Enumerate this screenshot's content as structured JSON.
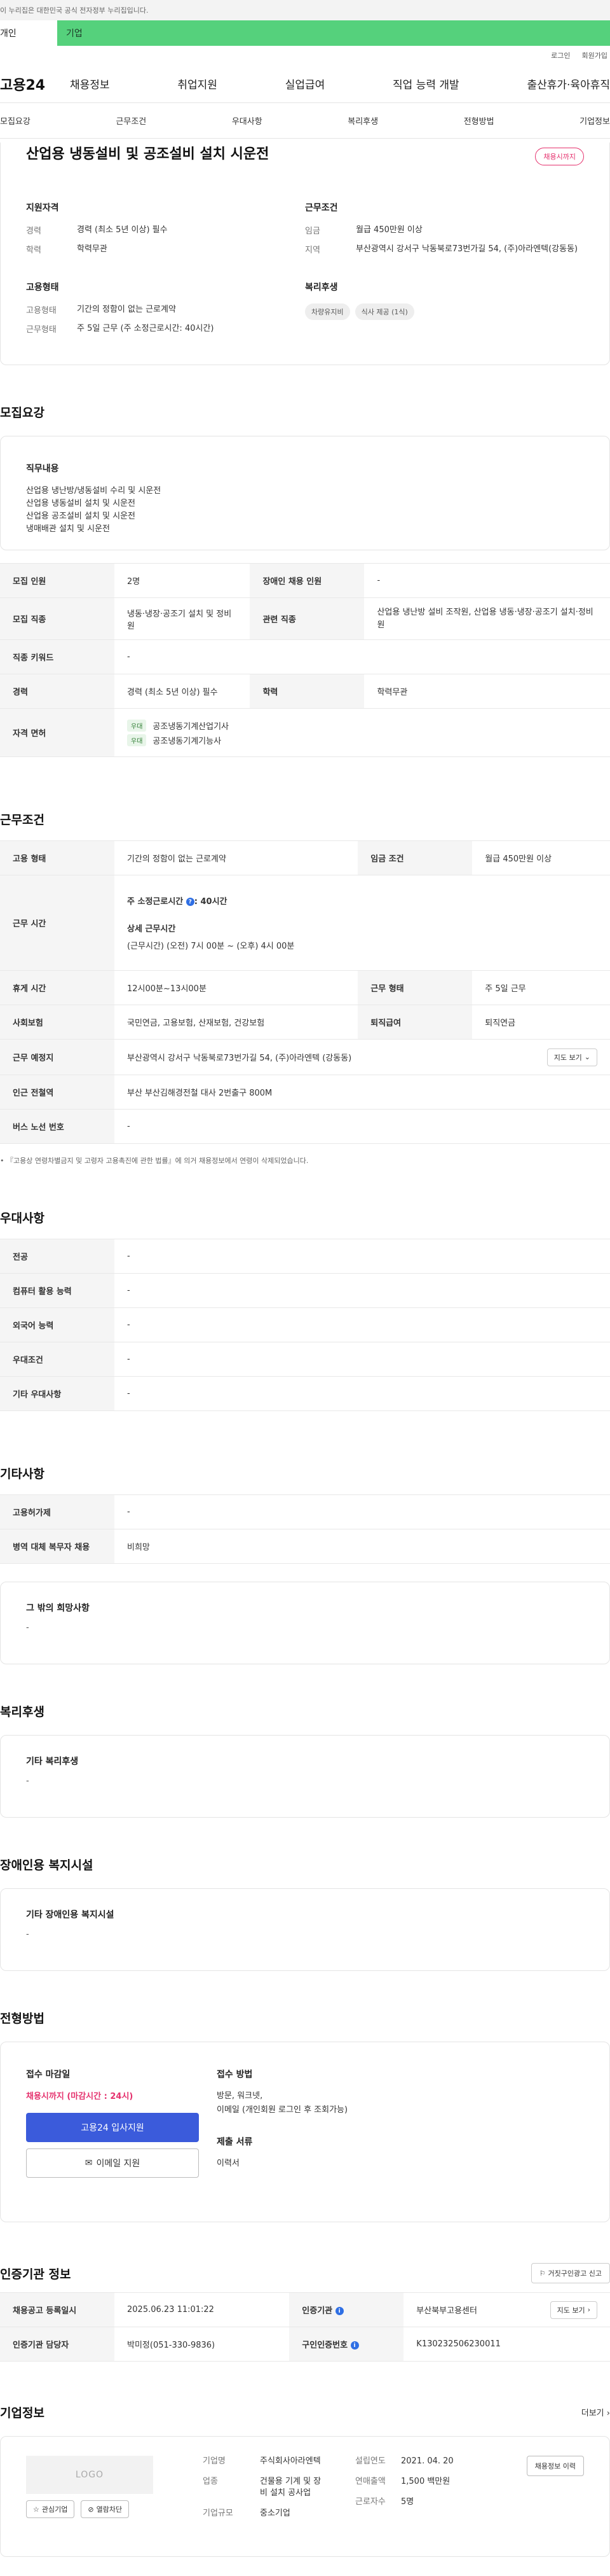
{
  "gov_bar": "이 누리집은 대한민국 공식 전자정부 누리집입니다.",
  "top_tabs": [
    "개인",
    "기업"
  ],
  "util": [
    "로그인",
    "회원가입"
  ],
  "logo": "고용24",
  "gnb": [
    "채용정보",
    "취업지원",
    "실업급여",
    "직업 능력 개발",
    "출산휴가·육아휴직"
  ],
  "subnav": [
    "모집요강",
    "근무조건",
    "우대사항",
    "복리후생",
    "전형방법",
    "기업정보"
  ],
  "summary": {
    "title": "산업용 냉동설비 및 공조설비 설치 시운전",
    "badge": "채용시까지",
    "qual_head": "지원자격",
    "qual": [
      {
        "k": "경력",
        "v": "경력 (최소 5년 이상) 필수"
      },
      {
        "k": "학력",
        "v": "학력무관"
      }
    ],
    "cond_head": "근무조건",
    "cond": [
      {
        "k": "임금",
        "v": "월급 450만원 이상"
      },
      {
        "k": "지역",
        "v": "부산광역시 강서구 낙동북로73번가길 54, (주)아라엔텍(강동동)"
      }
    ],
    "emp_head": "고용형태",
    "emp": [
      {
        "k": "고용형태",
        "v": "기간의 정함이 없는 근로계약"
      },
      {
        "k": "근무형태",
        "v": "주 5일 근무 (주 소정근로시간: 40시간)"
      }
    ],
    "welfare_head": "복리후생",
    "welfare": [
      "차량유지비",
      "식사 제공 (1식)"
    ]
  },
  "recruit": {
    "title": "모집요강",
    "job_head": "직무내용",
    "job_lines": [
      "산업용 냉난방/냉동설비 수리 및 시운전",
      "산업용 냉동설비 설치 및 시운전",
      "산업용 공조설비 설치 및 시운전",
      "냉매배관 설치 및 시운전"
    ],
    "rows": {
      "headcount_k": "모집 인원",
      "headcount_v": "2명",
      "disabled_k": "장애인 채용 인원",
      "disabled_v": "-",
      "job_k": "모집 직종",
      "job_v": "냉동·냉장·공조기 설치 및 정비원",
      "related_k": "관련 직종",
      "related_v": "산업용 냉난방 설비 조작원, 산업용 냉동·냉장·공조기 설치·정비원",
      "keyword_k": "직종 키워드",
      "keyword_v": "-",
      "career_k": "경력",
      "career_v": "경력 (최소 5년 이상) 필수",
      "edu_k": "학력",
      "edu_v": "학력무관",
      "license_k": "자격 면허",
      "licenses": [
        {
          "tag": "우대",
          "name": "공조냉동기계산업기사"
        },
        {
          "tag": "우대",
          "name": "공조냉동기계기능사"
        }
      ]
    }
  },
  "work": {
    "title": "근무조건",
    "type_k": "고용 형태",
    "type_v": "기간의 정함이 없는 근로계약",
    "pay_k": "임금 조건",
    "pay_v": "월급 450만원 이상",
    "hours_k": "근무 시간",
    "hours_a": "주 소정근로시간 ",
    "hours_b": ": 40시간",
    "hours_detail_head": "상세 근무시간",
    "hours_detail": "(근무시간) (오전) 7시 00분 ~ (오후) 4시 00분",
    "break_k": "휴게 시간",
    "break_v": "12시00분~13시00분",
    "shift_k": "근무 형태",
    "shift_v": "주 5일 근무",
    "ins_k": "사회보험",
    "ins_v": "국민연금, 고용보험, 산재보험, 건강보험",
    "sev_k": "퇴직급여",
    "sev_v": "퇴직연금",
    "loc_k": "근무 예정지",
    "loc_v": "부산광역시 강서구 낙동북로73번가길 54, (주)아라엔텍 (강동동)",
    "map_btn": "지도 보기",
    "subway_k": "인근 전철역",
    "subway_v": "부산 부산김해경전철 대사 2번출구 800M",
    "bus_k": "버스 노선 번호",
    "bus_v": "-",
    "note": "『고용상 연령차별금지 및 고령자 고용촉진에 관한 법률』에 의거 채용정보에서 연령이 삭제되었습니다."
  },
  "pref": {
    "title": "우대사항",
    "rows": [
      {
        "k": "전공",
        "v": "-"
      },
      {
        "k": "컴퓨터 활용 능력",
        "v": "-"
      },
      {
        "k": "외국어 능력",
        "v": "-"
      },
      {
        "k": "우대조건",
        "v": "-"
      },
      {
        "k": "기타 우대사항",
        "v": "-"
      }
    ]
  },
  "etc": {
    "title": "기타사항",
    "rows": [
      {
        "k": "고용허가제",
        "v": "-"
      },
      {
        "k": "병역 대체 복무자 채용",
        "v": "비희망"
      }
    ],
    "other_head": "그 밖의 희망사항",
    "other_v": "-"
  },
  "welfare": {
    "title": "복리후생",
    "head": "기타 복리후생",
    "v": "-"
  },
  "disab": {
    "title": "장애인용 복지시설",
    "head": "기타 장애인용 복지시설",
    "v": "-"
  },
  "apply": {
    "title": "전형방법",
    "deadline_head": "접수 마감일",
    "deadline": "채용시까지 (마감시간 : 24시)",
    "btn_apply": "고용24 입사지원",
    "btn_email": "이메일 지원",
    "method_head": "접수 방법",
    "method_v1": "방문, 워크넷,",
    "method_v2": "이메일 (개인회원 로그인 후 조회가능)",
    "docs_head": "제출 서류",
    "docs_v": "이력서"
  },
  "cert": {
    "title": "인증기관 정보",
    "report_btn": "거짓구인광고 신고",
    "reg_k": "채용공고 등록일시",
    "reg_v": "2025.06.23 11:01:22",
    "org_k": "인증기관",
    "org_v": "부산북부고용센터",
    "map_btn": "지도 보기",
    "mgr_k": "인증기관 담당자",
    "mgr_v": "박미정(051-330-9836)",
    "no_k": "구인인증번호",
    "no_v": "K130232506230011"
  },
  "company": {
    "title": "기업정보",
    "more": "더보기",
    "logo": "LOGO",
    "btn_fav": "관심기업",
    "btn_block": "열람차단",
    "btn_reviews": "채용정보 이력",
    "name_k": "기업명",
    "name_v": "주식회사아라엔텍",
    "biz_k": "업종",
    "biz_v1": "건물용 기계 및 장",
    "biz_v2": "비 설치 공사업",
    "size_k": "기업규모",
    "size_v": "중소기업",
    "year_k": "설립연도",
    "year_v": "2021. 04. 20",
    "sales_k": "연매출액",
    "sales_v": "1,500 백만원",
    "staff_k": "근로자수",
    "staff_v": "5명"
  }
}
